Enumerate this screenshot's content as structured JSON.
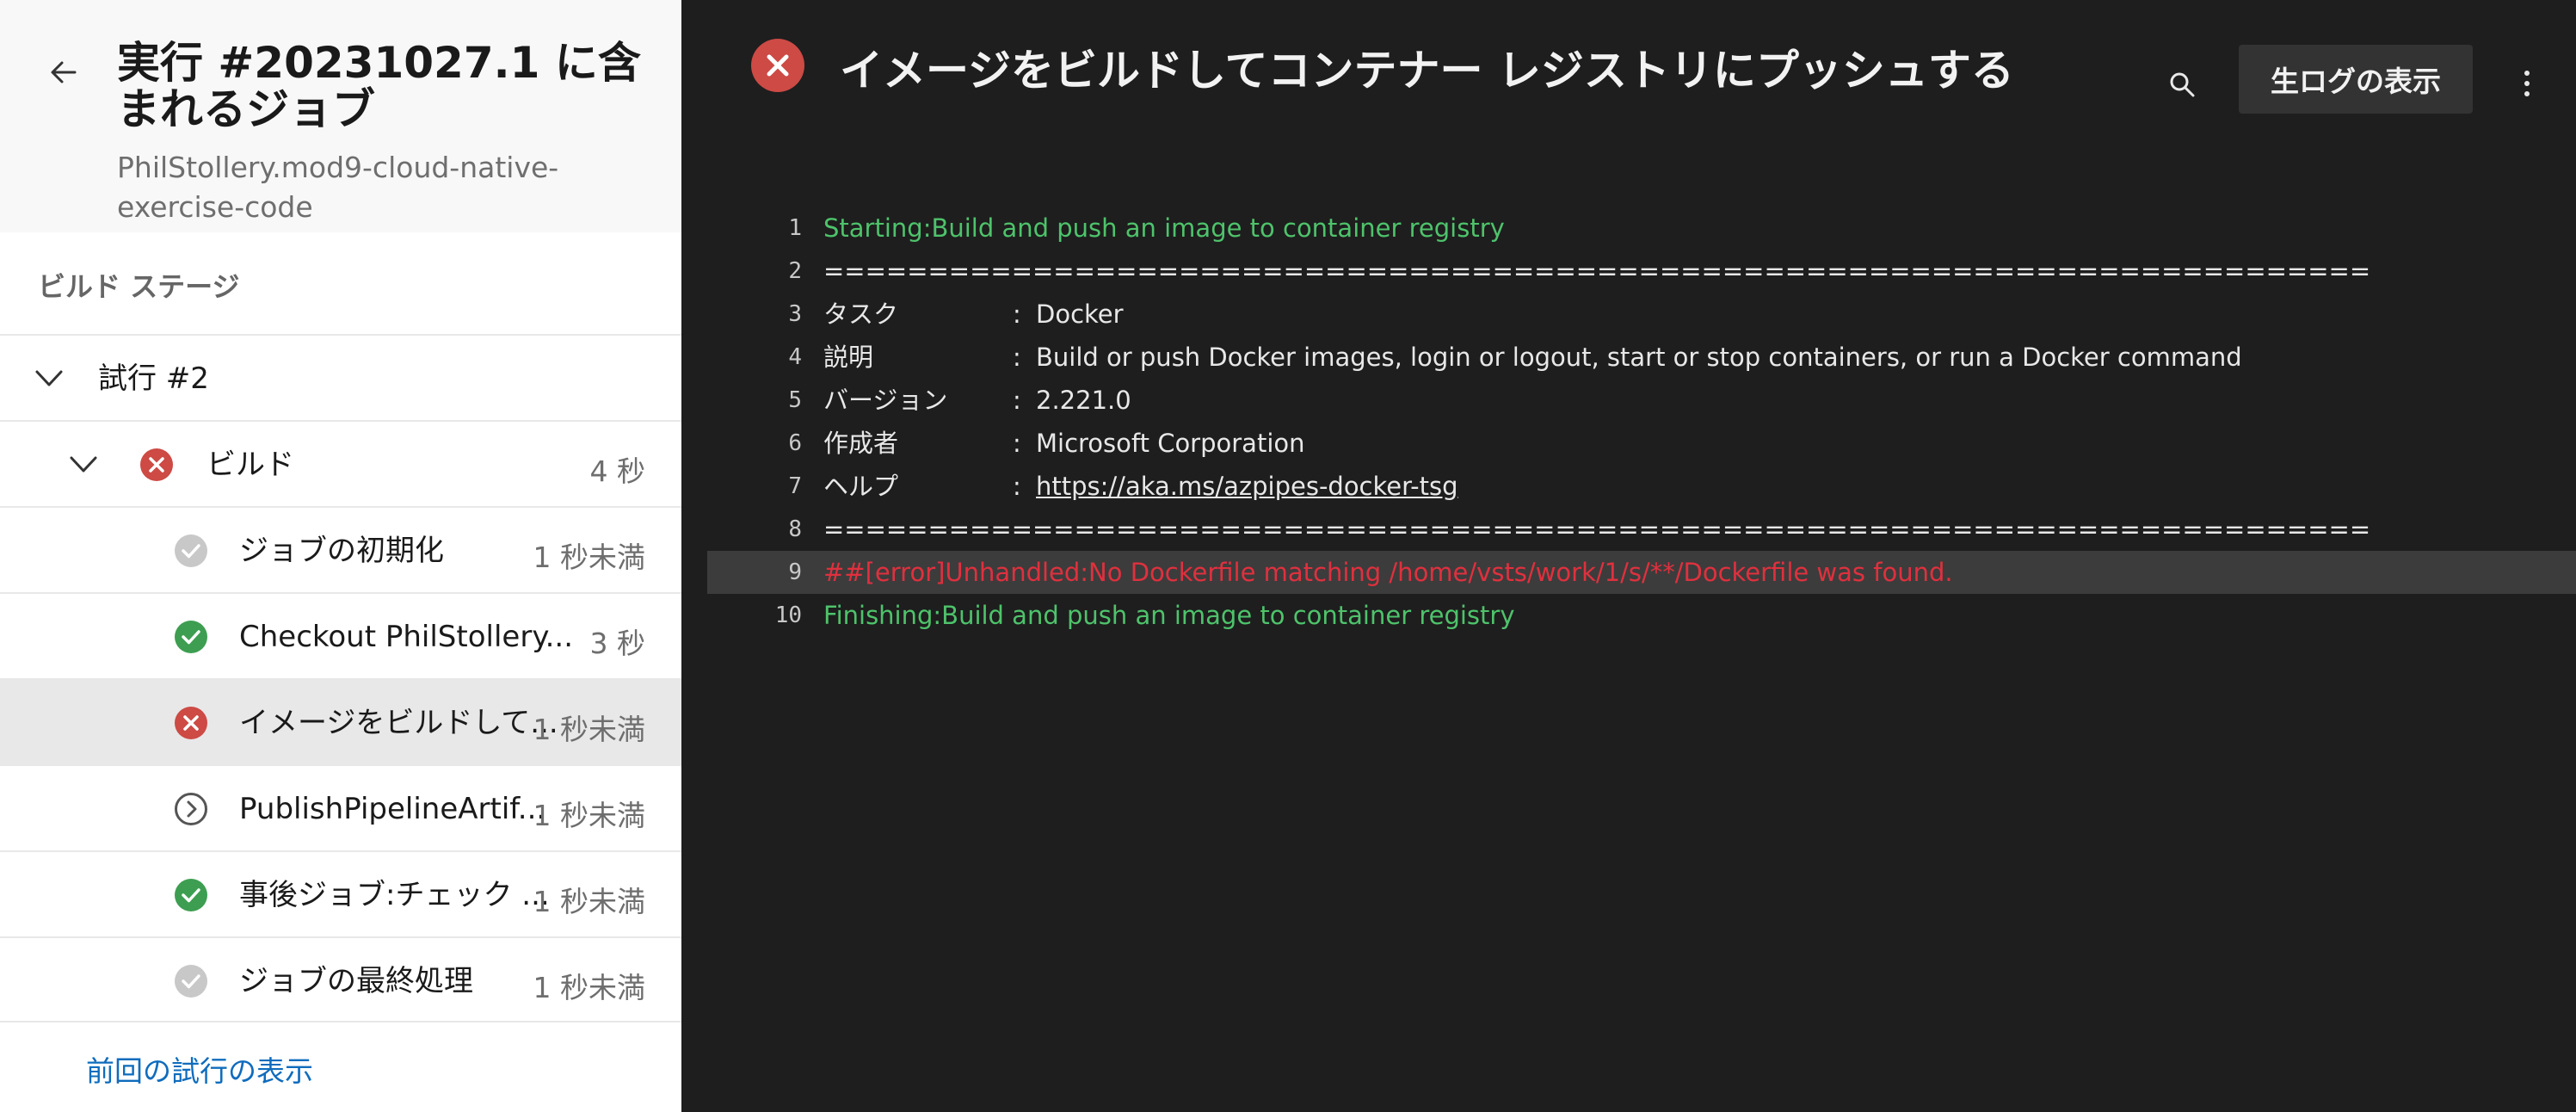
{
  "header": {
    "title": "実行 #20231027.1 に含まれるジョブ",
    "subtitle": "PhilStollery.mod9-cloud-native-exercise-code"
  },
  "stage_label": "ビルド ステージ",
  "attempt": {
    "label": "試行 #2"
  },
  "job": {
    "label": "ビルド",
    "duration": "4 秒"
  },
  "steps": [
    {
      "label": "ジョブの初期化",
      "duration": "1 秒未満",
      "status": "skipped"
    },
    {
      "label": "Checkout PhilStollery...",
      "duration": "3 秒",
      "status": "success"
    },
    {
      "label": "イメージをビルドして...",
      "duration": "1 秒未満",
      "status": "failed"
    },
    {
      "label": "PublishPipelineArtif...",
      "duration": "1 秒未満",
      "status": "pending"
    },
    {
      "label": "事後ジョブ:チェック ...",
      "duration": "1 秒未満",
      "status": "success"
    },
    {
      "label": "ジョブの最終処理",
      "duration": "1 秒未満",
      "status": "skipped"
    }
  ],
  "footer_link": "前回の試行の表示",
  "log": {
    "title": "イメージをビルドしてコンテナー レジストリにプッシュする",
    "raw_button": "生ログの表示",
    "lines": [
      {
        "n": "1",
        "text": "Starting:Build and push an image to container registry"
      },
      {
        "n": "2",
        "text": "=========================================================================="
      },
      {
        "n": "3",
        "key": "タスク",
        "colon": ":",
        "value": "Docker"
      },
      {
        "n": "4",
        "key": "説明",
        "colon": ":",
        "value": "Build or push Docker images, login or logout, start or stop containers, or run a Docker command"
      },
      {
        "n": "5",
        "key": "バージョン",
        "colon": ":",
        "value": "2.221.0"
      },
      {
        "n": "6",
        "key": "作成者",
        "colon": ":",
        "value": "Microsoft Corporation"
      },
      {
        "n": "7",
        "key": "ヘルプ",
        "colon": ":",
        "value": "https://aka.ms/azpipes-docker-tsg"
      },
      {
        "n": "8",
        "text": "=========================================================================="
      },
      {
        "n": "9",
        "text": "##[error]Unhandled:No Dockerfile matching  /home/vsts/work/1/s/**/Dockerfile  was found."
      },
      {
        "n": "10",
        "text": "Finishing:Build and push an image to container registry"
      }
    ]
  },
  "colors": {
    "success": "#3d9e51",
    "failed": "#cd4a45",
    "skipped": "#c8c8c8",
    "link": "#0f6cbd",
    "log_green": "#4ec36b",
    "log_red": "#e0303e"
  },
  "icons": {
    "back": "back-arrow-icon",
    "search": "search-icon",
    "more": "more-vertical-icon"
  }
}
